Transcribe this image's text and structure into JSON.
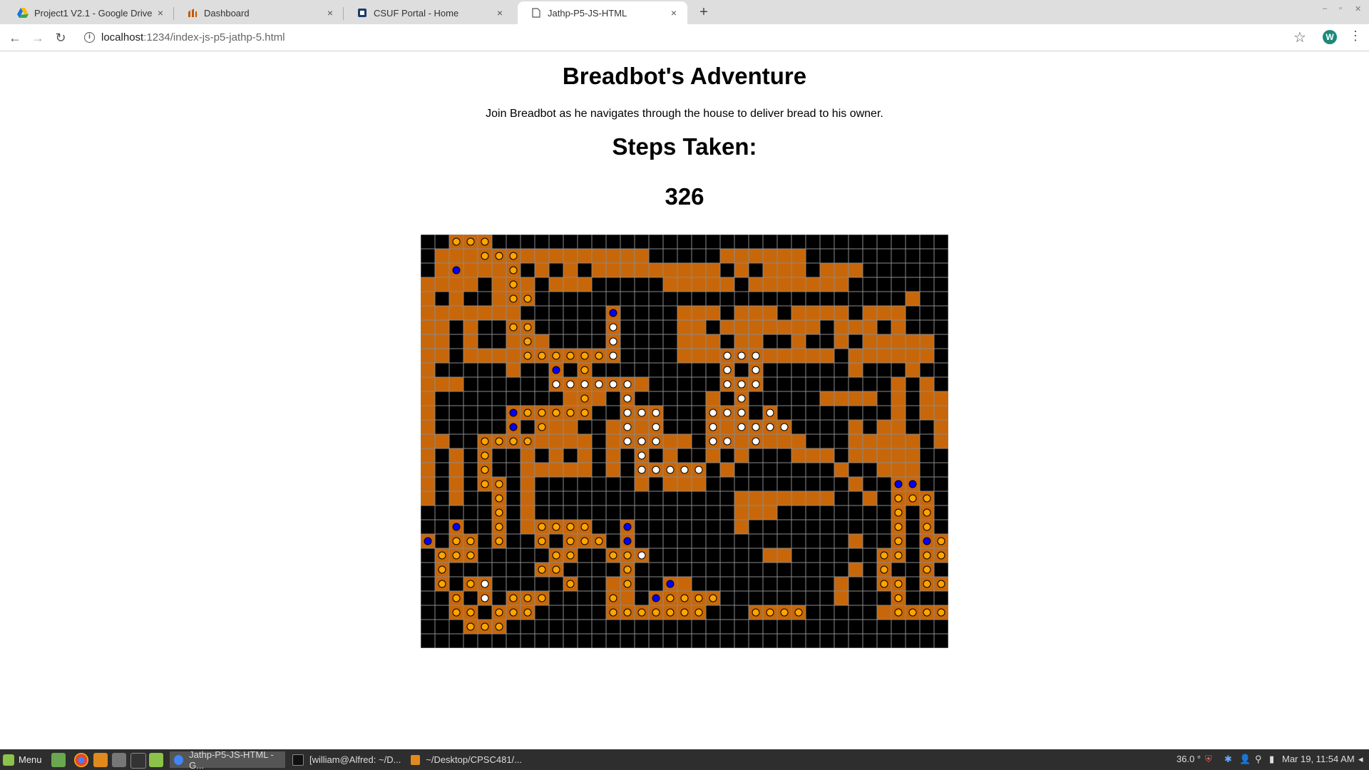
{
  "browser": {
    "tabs": [
      {
        "label": "Project1 V2.1 - Google Drive",
        "icon": "google-drive-icon",
        "active": false
      },
      {
        "label": "Dashboard",
        "icon": "dashboard-icon",
        "active": false
      },
      {
        "label": "CSUF Portal - Home",
        "icon": "portal-icon",
        "active": false
      },
      {
        "label": "Jathp-P5-JS-HTML",
        "icon": "page-icon",
        "active": true
      }
    ],
    "close_glyph": "×",
    "new_tab_glyph": "+",
    "url_host": "localhost",
    "url_path": ":1234/index-js-p5-jathp-5.html",
    "profile_initial": "W"
  },
  "page": {
    "title": "Breadbot's Adventure",
    "description": "Join Breadbot as he navigates through the house to deliver bread to his owner.",
    "steps_heading": "Steps Taken:",
    "steps_value": "326"
  },
  "maze": {
    "cols": 37,
    "rows": 29,
    "colors": {
      "wall": "#000000",
      "floor": "#c8670a",
      "grid": "#8a8a8a",
      "visited": "#ffa500",
      "explored": "#ffffff",
      "bot": "#0000ff",
      "start": "#2e8b00",
      "goal": "#ffff00"
    },
    "grid": [
      ".....................................",
      ".####..#########.....######..........",
      ".######.#.#.#########.#.###.###......",
      "####.###.###.....#####.#######.......",
      "#.#..#.#..........................#..",
      "#######...........###.###.####.###...",
      "##.#..#...........##.#######.###.#...",
      "##.#..###.........###.##..#..#.#####.",
      "##.####...........###.#######.######.",
      "#.....#.......................#...#..",
      "###.......######.....###.........#.#.",
      "#.........#.#.#.....#.#.....####.#.##",
      "#................................#.##",
      "#.......###..####...###.......#.##..#",
      "##.....#####.######.#.#####...#####.#",
      "#.#....#.#.#.#.#.#..#.#...###.#####..",
      "#.#....#####.#.#.#.#.#.......#..###..",
      "#.#....#.......#.###..........#..#...",
      "#.#....#..............#######..#.....",
      ".......#..............###...........",
      ".......#.#............#.............",
      "..............................#......",
      "..#.....................##...........",
      "..............................#......",
      ".............#...##..........#......",
      "..............#..............#......",
      "................................#.#..",
      ".....................................",
      "....................................."
    ],
    "trail": [
      "..vvv................................",
      "....vvv..............................",
      "..b...v..............................",
      "......v..............................",
      "......vv.............................",
      ".............b.......................",
      "......vv.....w.......................",
      ".......v.....w.......................",
      ".......vvvvvvw.......www.............",
      ".........b.v.........w.w.............",
      ".........wwwwww......www.............",
      "...........v..w.......w..............",
      "......bvvvvv..www...www.w............",
      "......b.v.....w.w...w.wwww...........",
      "....vvvv......www...ww.w.............",
      "....v..........w.....................",
      "....v..........wwwww.................",
      "....vv...........................bb..",
      ".....v...........................vvv.",
      ".....v...........................v.v.",
      "..b..v..vvvv..b..................v.v.",
      "b.vv.v..v.vvv.b..................v.bvb",
      ".vvv.....vv..vvw................vv.vvv",
      ".v......vv....v.................v..v.v",
      ".v.vw.....v...v..b..............vv.vv",
      "..v.w.vvv....v..bvvvv............v....",
      "..vv.vvv.....vvvvvvv...vvvv......vvvvy",
      "...vvv...............................",
      "....................................."
    ]
  }
}
